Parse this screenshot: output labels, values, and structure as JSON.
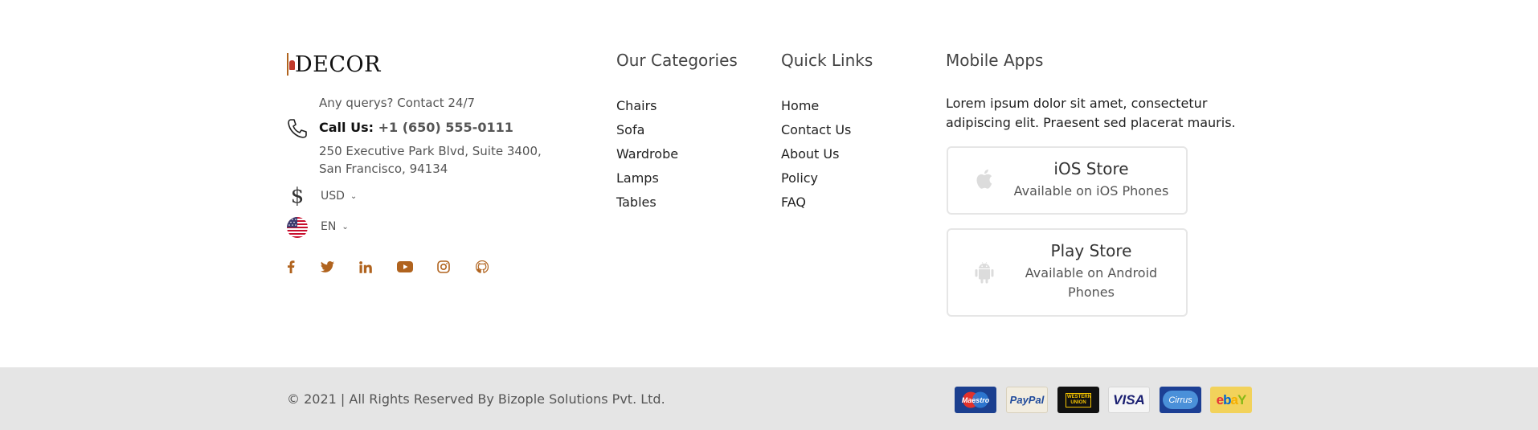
{
  "brand": {
    "logo_text": "DECOR"
  },
  "contact": {
    "note": "Any querys? Contact 24/7",
    "call_label": "Call Us:",
    "phone": "+1 (650) 555-0111",
    "address_line1": "250 Executive Park Blvd, Suite 3400,",
    "address_line2": "San Francisco, 94134"
  },
  "currency": {
    "selected": "USD"
  },
  "language": {
    "selected": "EN"
  },
  "social": [
    "facebook-icon",
    "twitter-icon",
    "linkedin-icon",
    "youtube-icon",
    "instagram-icon",
    "github-icon"
  ],
  "categories": {
    "title": "Our Categories",
    "items": [
      "Chairs",
      "Sofa",
      "Wardrobe",
      "Lamps",
      "Tables"
    ]
  },
  "quick_links": {
    "title": "Quick Links",
    "items": [
      "Home",
      "Contact Us",
      "About Us",
      "Policy",
      "FAQ"
    ]
  },
  "mobile_apps": {
    "title": "Mobile Apps",
    "description": "Lorem ipsum dolor sit amet, consectetur adipiscing elit. Praesent sed placerat mauris.",
    "ios": {
      "name": "iOS Store",
      "sub": "Available on iOS Phones"
    },
    "play": {
      "name": "Play Store",
      "sub": "Available on Android Phones"
    }
  },
  "footer": {
    "copyright": "© 2021 | All Rights Reserved By Bizople Solutions Pvt. Ltd.",
    "payments": {
      "maestro": "Maestro",
      "paypal": "PayPal",
      "western_union": "WESTERN UNION",
      "visa": "VISA",
      "cirrus": "Cirrus",
      "ebay_e": "e",
      "ebay_b": "b",
      "ebay_a": "a",
      "ebay_y": "Y"
    }
  },
  "colors": {
    "accent": "#b0631e",
    "bottom_bar": "#e5e5e5",
    "card_border": "#e6e6e6"
  }
}
